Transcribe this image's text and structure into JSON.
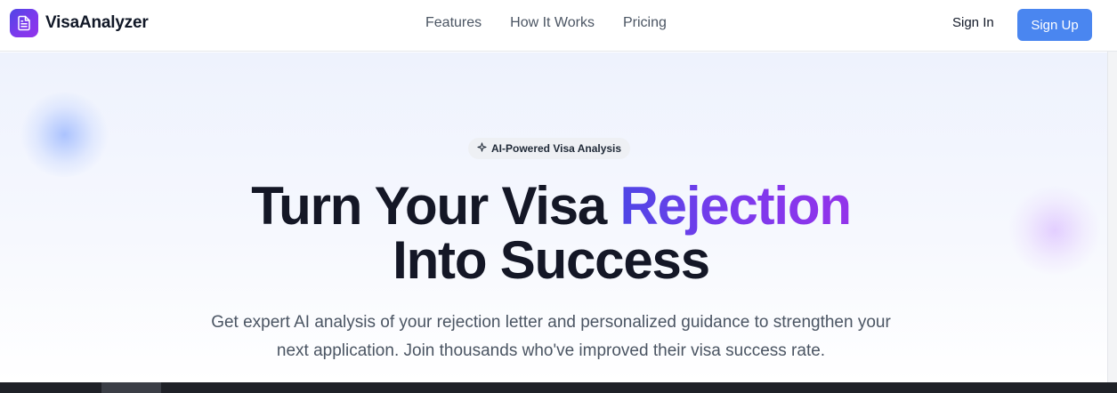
{
  "brand": {
    "name": "VisaAnalyzer",
    "icon": "document-icon"
  },
  "nav": {
    "links": [
      {
        "label": "Features"
      },
      {
        "label": "How It Works"
      },
      {
        "label": "Pricing"
      }
    ],
    "sign_in_label": "Sign In",
    "sign_up_label": "Sign Up"
  },
  "hero": {
    "badge": {
      "icon": "sparkle-icon",
      "label": "AI-Powered Visa Analysis"
    },
    "headline_part1": "Turn Your Visa ",
    "headline_accent": "Rejection",
    "headline_part2": "Into Success",
    "subtext": "Get expert AI analysis of your rejection letter and personalized guidance to strengthen your next application. Join thousands who've improved their visa success rate."
  },
  "colors": {
    "accent_start": "#4f46e5",
    "accent_end": "#9333ea",
    "signup_button": "#4a86f0",
    "heading": "#141726",
    "body_text": "#4b5563"
  }
}
